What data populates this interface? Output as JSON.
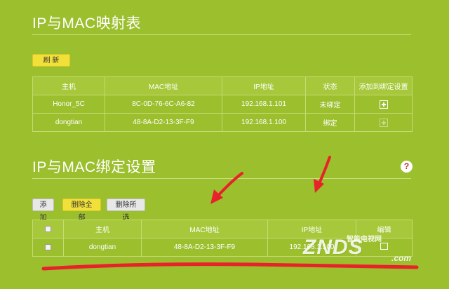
{
  "section1": {
    "title": "IP与MAC映射表",
    "refresh_label": "刷 新"
  },
  "table1": {
    "headers": [
      "主机",
      "MAC地址",
      "IP地址",
      "状态",
      "添加到绑定设置"
    ],
    "rows": [
      {
        "host": "Honor_5C",
        "mac": "8C-0D-76-6C-A6-82",
        "ip": "192.168.1.101",
        "status": "未绑定"
      },
      {
        "host": "dongtian",
        "mac": "48-8A-D2-13-3F-F9",
        "ip": "192.168.1.100",
        "status": "绑定"
      }
    ]
  },
  "section2": {
    "title": "IP与MAC绑定设置",
    "help": "?",
    "add_label": "添加",
    "delete_all_label": "删除全部",
    "delete_selected_label": "删除所选"
  },
  "table2": {
    "headers": [
      "主机",
      "MAC地址",
      "IP地址",
      "编辑"
    ],
    "rows": [
      {
        "host": "dongtian",
        "mac": "48-8A-D2-13-3F-F9",
        "ip": "192.168.1.100"
      }
    ]
  },
  "watermark": {
    "main": "ZNDS",
    "sub": "智能电视网",
    "suffix": ".com"
  },
  "colors": {
    "background": "#9cbf2e",
    "annotation_red": "#e8222a"
  },
  "icons": [
    "plus-icon",
    "help-icon",
    "checkbox",
    "edit-icon"
  ]
}
